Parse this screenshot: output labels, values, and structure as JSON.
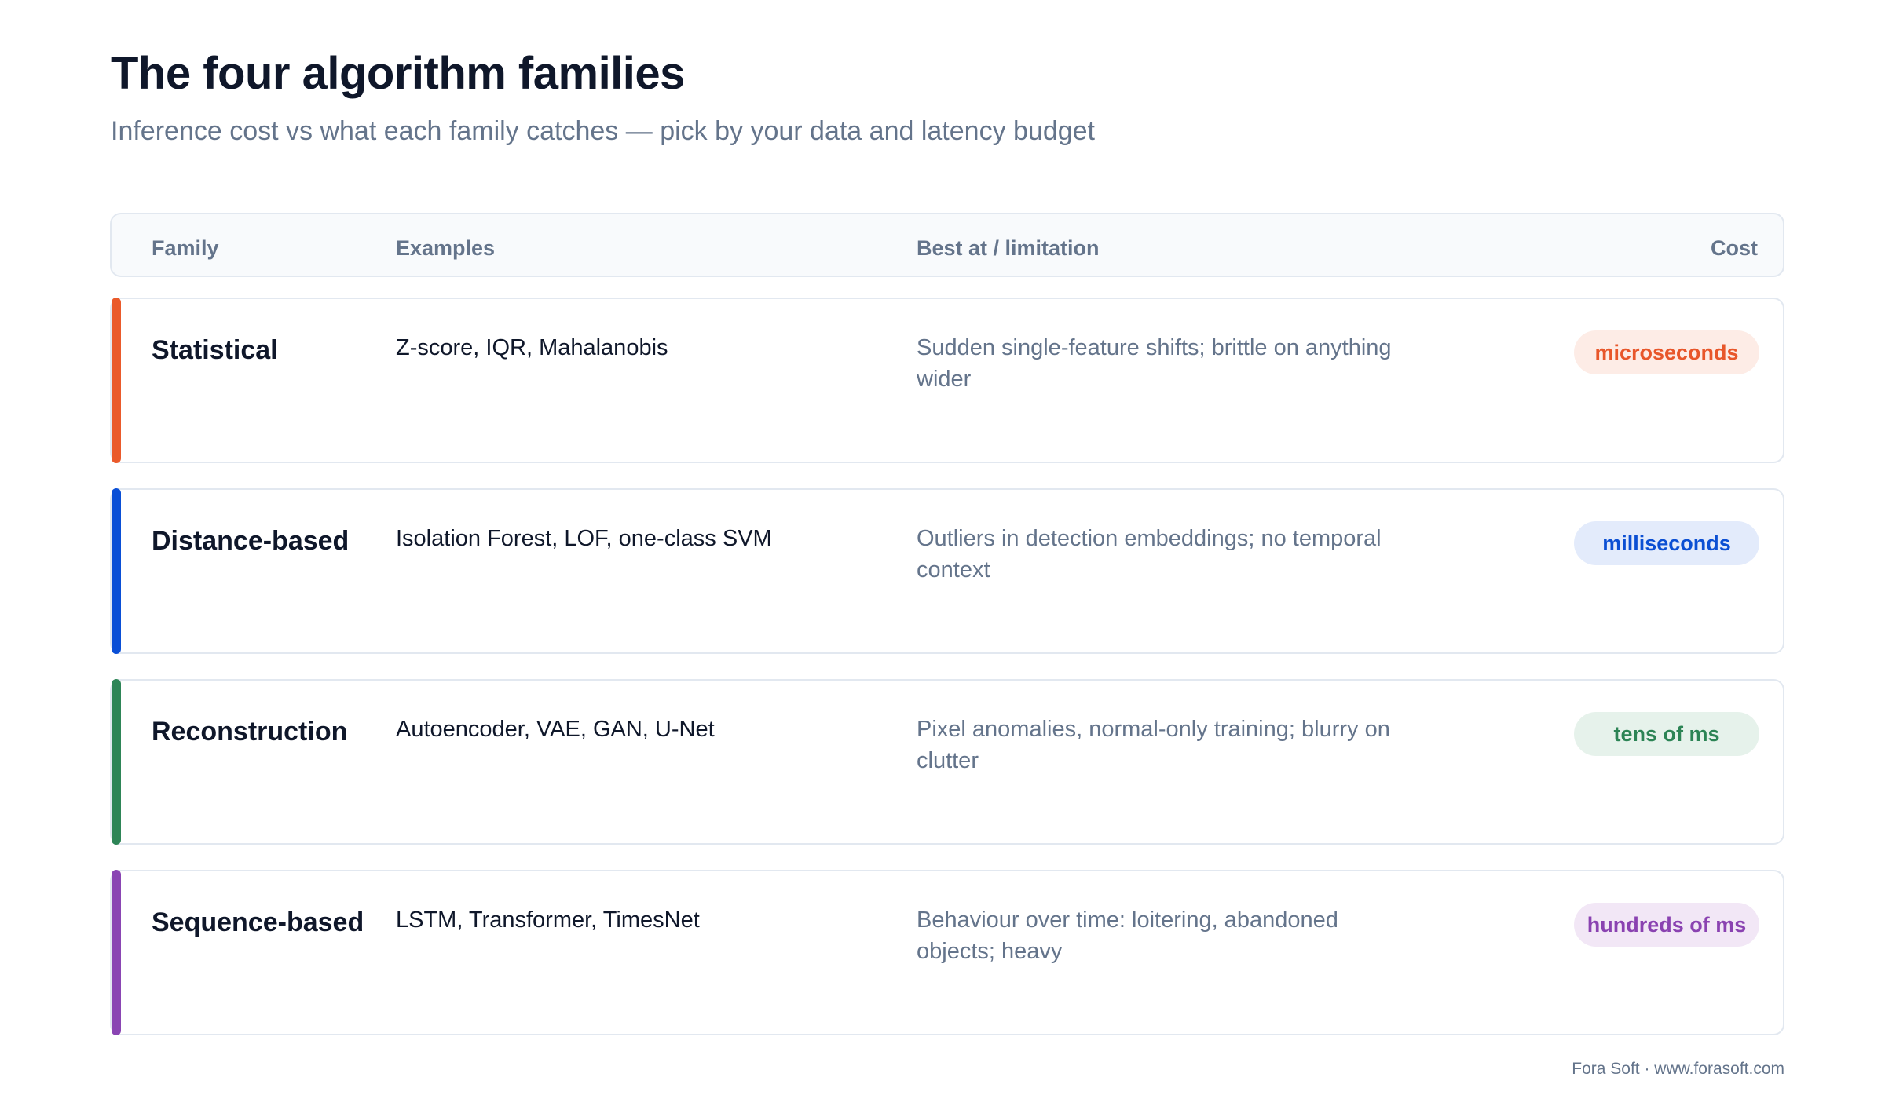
{
  "header": {
    "title": "The four algorithm families",
    "subtitle": "Inference cost vs what each family catches — pick by your data and latency budget"
  },
  "table": {
    "columns": {
      "family": "Family",
      "examples": "Examples",
      "best": "Best at / limitation",
      "cost": "Cost"
    },
    "rows": [
      {
        "family": "Statistical",
        "examples": "Z-score, IQR, Mahalanobis",
        "best": "Sudden single-feature shifts; brittle on anything wider",
        "cost": "microseconds",
        "accent_color": "#ea5a2b",
        "pill_bg": "#fdece6",
        "pill_color": "#e8562a"
      },
      {
        "family": "Distance-based",
        "examples": "Isolation Forest, LOF, one-class SVM",
        "best": "Outliers in detection embeddings; no temporal context",
        "cost": "milliseconds",
        "accent_color": "#0a4fd6",
        "pill_bg": "#e3ebfb",
        "pill_color": "#0b4fd3"
      },
      {
        "family": "Reconstruction",
        "examples": "Autoencoder, VAE, GAN, U-Net",
        "best": "Pixel anomalies, normal-only training; blurry on clutter",
        "cost": "tens of ms",
        "accent_color": "#2e8557",
        "pill_bg": "#e6f2eb",
        "pill_color": "#2c8455"
      },
      {
        "family": "Sequence-based",
        "examples": "LSTM, Transformer, TimesNet",
        "best": "Behaviour over time: loitering, abandoned objects; heavy",
        "cost": "hundreds of ms",
        "accent_color": "#8a45b3",
        "pill_bg": "#f2e7f6",
        "pill_color": "#8a42b1"
      }
    ]
  },
  "footer": {
    "text": "Fora Soft · www.forasoft.com"
  }
}
